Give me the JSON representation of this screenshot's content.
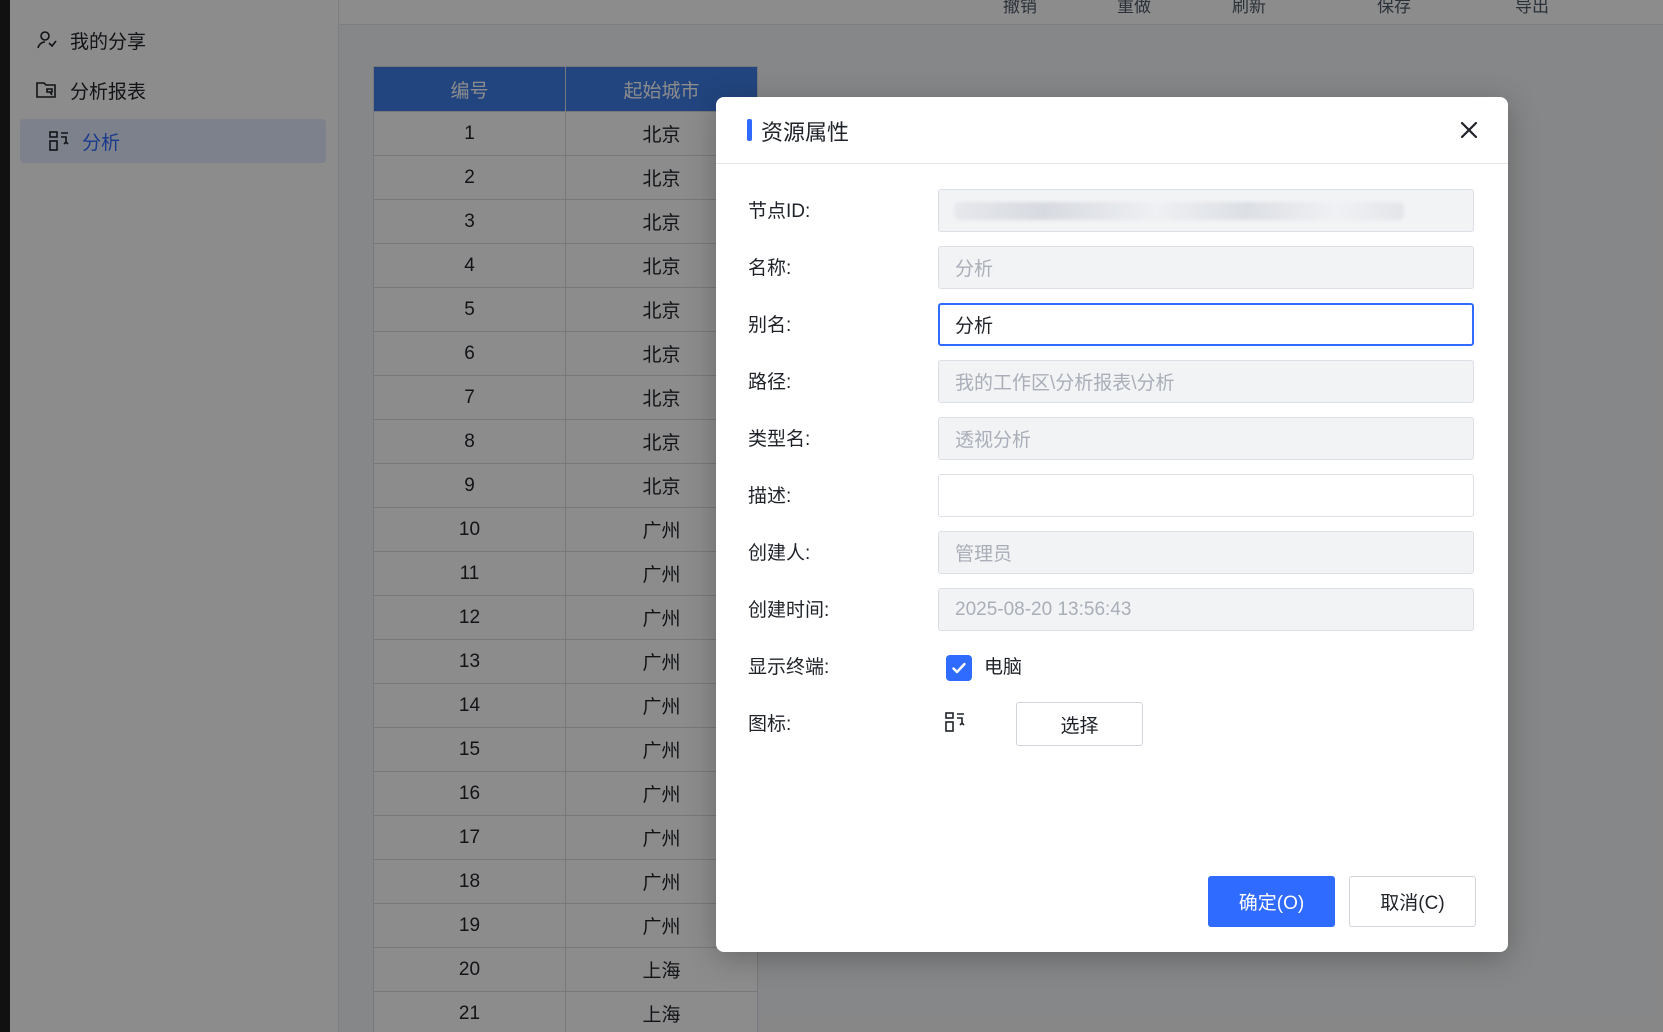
{
  "sidebar": {
    "items": [
      {
        "label": "我的分享",
        "icon": "user-share-icon"
      },
      {
        "label": "分析报表",
        "icon": "folder-report-icon"
      },
      {
        "label": "分析",
        "icon": "pivot-analysis-icon",
        "active": true
      }
    ]
  },
  "toolbar": {
    "items": [
      "撤销",
      "重做",
      "刷新",
      "保存",
      "导出"
    ]
  },
  "table": {
    "headers": [
      "编号",
      "起始城市"
    ],
    "rows": [
      [
        "1",
        "北京"
      ],
      [
        "2",
        "北京"
      ],
      [
        "3",
        "北京"
      ],
      [
        "4",
        "北京"
      ],
      [
        "5",
        "北京"
      ],
      [
        "6",
        "北京"
      ],
      [
        "7",
        "北京"
      ],
      [
        "8",
        "北京"
      ],
      [
        "9",
        "北京"
      ],
      [
        "10",
        "广州"
      ],
      [
        "11",
        "广州"
      ],
      [
        "12",
        "广州"
      ],
      [
        "13",
        "广州"
      ],
      [
        "14",
        "广州"
      ],
      [
        "15",
        "广州"
      ],
      [
        "16",
        "广州"
      ],
      [
        "17",
        "广州"
      ],
      [
        "18",
        "广州"
      ],
      [
        "19",
        "广州"
      ],
      [
        "20",
        "上海"
      ],
      [
        "21",
        "上海"
      ]
    ]
  },
  "dialog": {
    "title": "资源属性",
    "fields": {
      "node_id_label": "节点ID:",
      "name_label": "名称:",
      "name_value": "分析",
      "alias_label": "别名:",
      "alias_value": "分析",
      "path_label": "路径:",
      "path_value": "我的工作区\\分析报表\\分析",
      "type_label": "类型名:",
      "type_value": "透视分析",
      "desc_label": "描述:",
      "desc_value": "",
      "creator_label": "创建人:",
      "creator_value": "管理员",
      "created_label": "创建时间:",
      "created_value": "2025-08-20 13:56:43",
      "terminal_label": "显示终端:",
      "terminal_option": "电脑",
      "icon_label": "图标:",
      "select_button": "选择"
    },
    "ok_button": "确定(O)",
    "cancel_button": "取消(C)"
  },
  "colors": {
    "accent": "#2f6bff",
    "table_header": "#3f7ee8",
    "overlay": "rgba(0,0,0,0.45)"
  }
}
